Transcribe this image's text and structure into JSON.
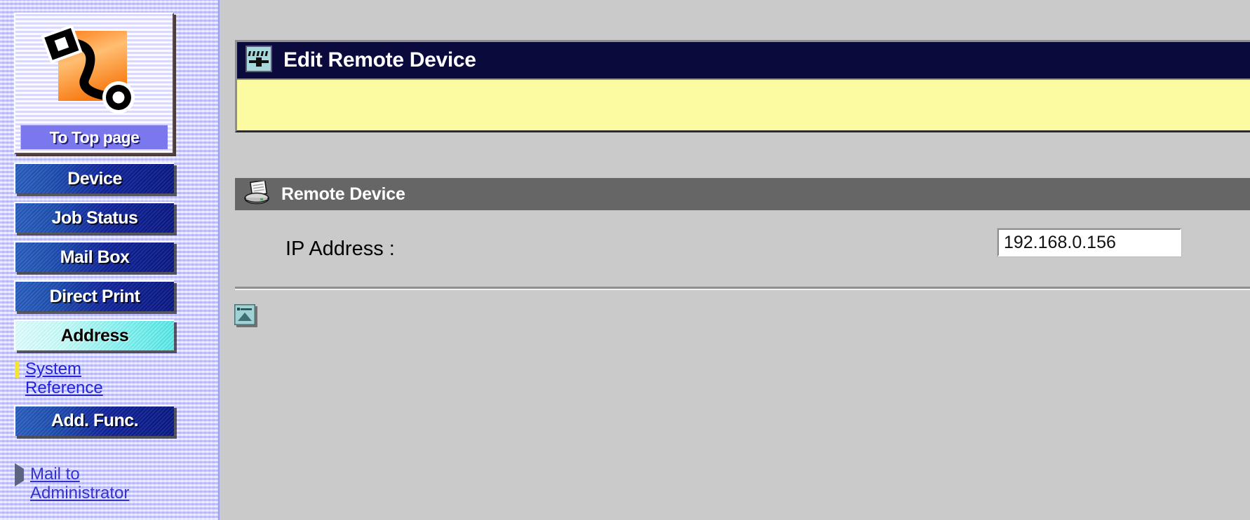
{
  "sidebar": {
    "logo": {
      "alt": "printer-network-logo",
      "top_page_label": "To Top page"
    },
    "buttons": [
      {
        "label": "Device",
        "name": "device",
        "active": false
      },
      {
        "label": "Job Status",
        "name": "job-status",
        "active": false
      },
      {
        "label": "Mail Box",
        "name": "mail-box",
        "active": false
      },
      {
        "label": "Direct Print",
        "name": "direct-print",
        "active": false
      },
      {
        "label": "Address",
        "name": "address",
        "active": true
      },
      {
        "label": "Add. Func.",
        "name": "add-func",
        "active": false
      }
    ],
    "links": [
      {
        "label": "System Reference",
        "name": "system-reference",
        "bullet": "square-bullet-icon"
      },
      {
        "label": "Mail to Administrator",
        "name": "mail-to-administrator",
        "bullet": "triangle-bullet-icon"
      }
    ]
  },
  "main": {
    "title_icon": "network-device-icon",
    "title": "Edit Remote Device",
    "message": "",
    "section": {
      "icon": "printer-icon",
      "title": "Remote Device"
    },
    "fields": [
      {
        "label": "IP Address :",
        "name": "ip-address",
        "value": "192.168.0.156",
        "placeholder": ""
      }
    ],
    "back_to_top_icon": "back-to-top-icon"
  },
  "colors": {
    "sidebar_bg": "#c3c9fb",
    "nav_button": "#10239c",
    "nav_button_active": "#79f0ee",
    "title_bar": "#0a0a3c",
    "message_bar": "#fdfba1",
    "section_bar": "#666666",
    "content_bg": "#cacaca",
    "link": "#2222dd"
  }
}
